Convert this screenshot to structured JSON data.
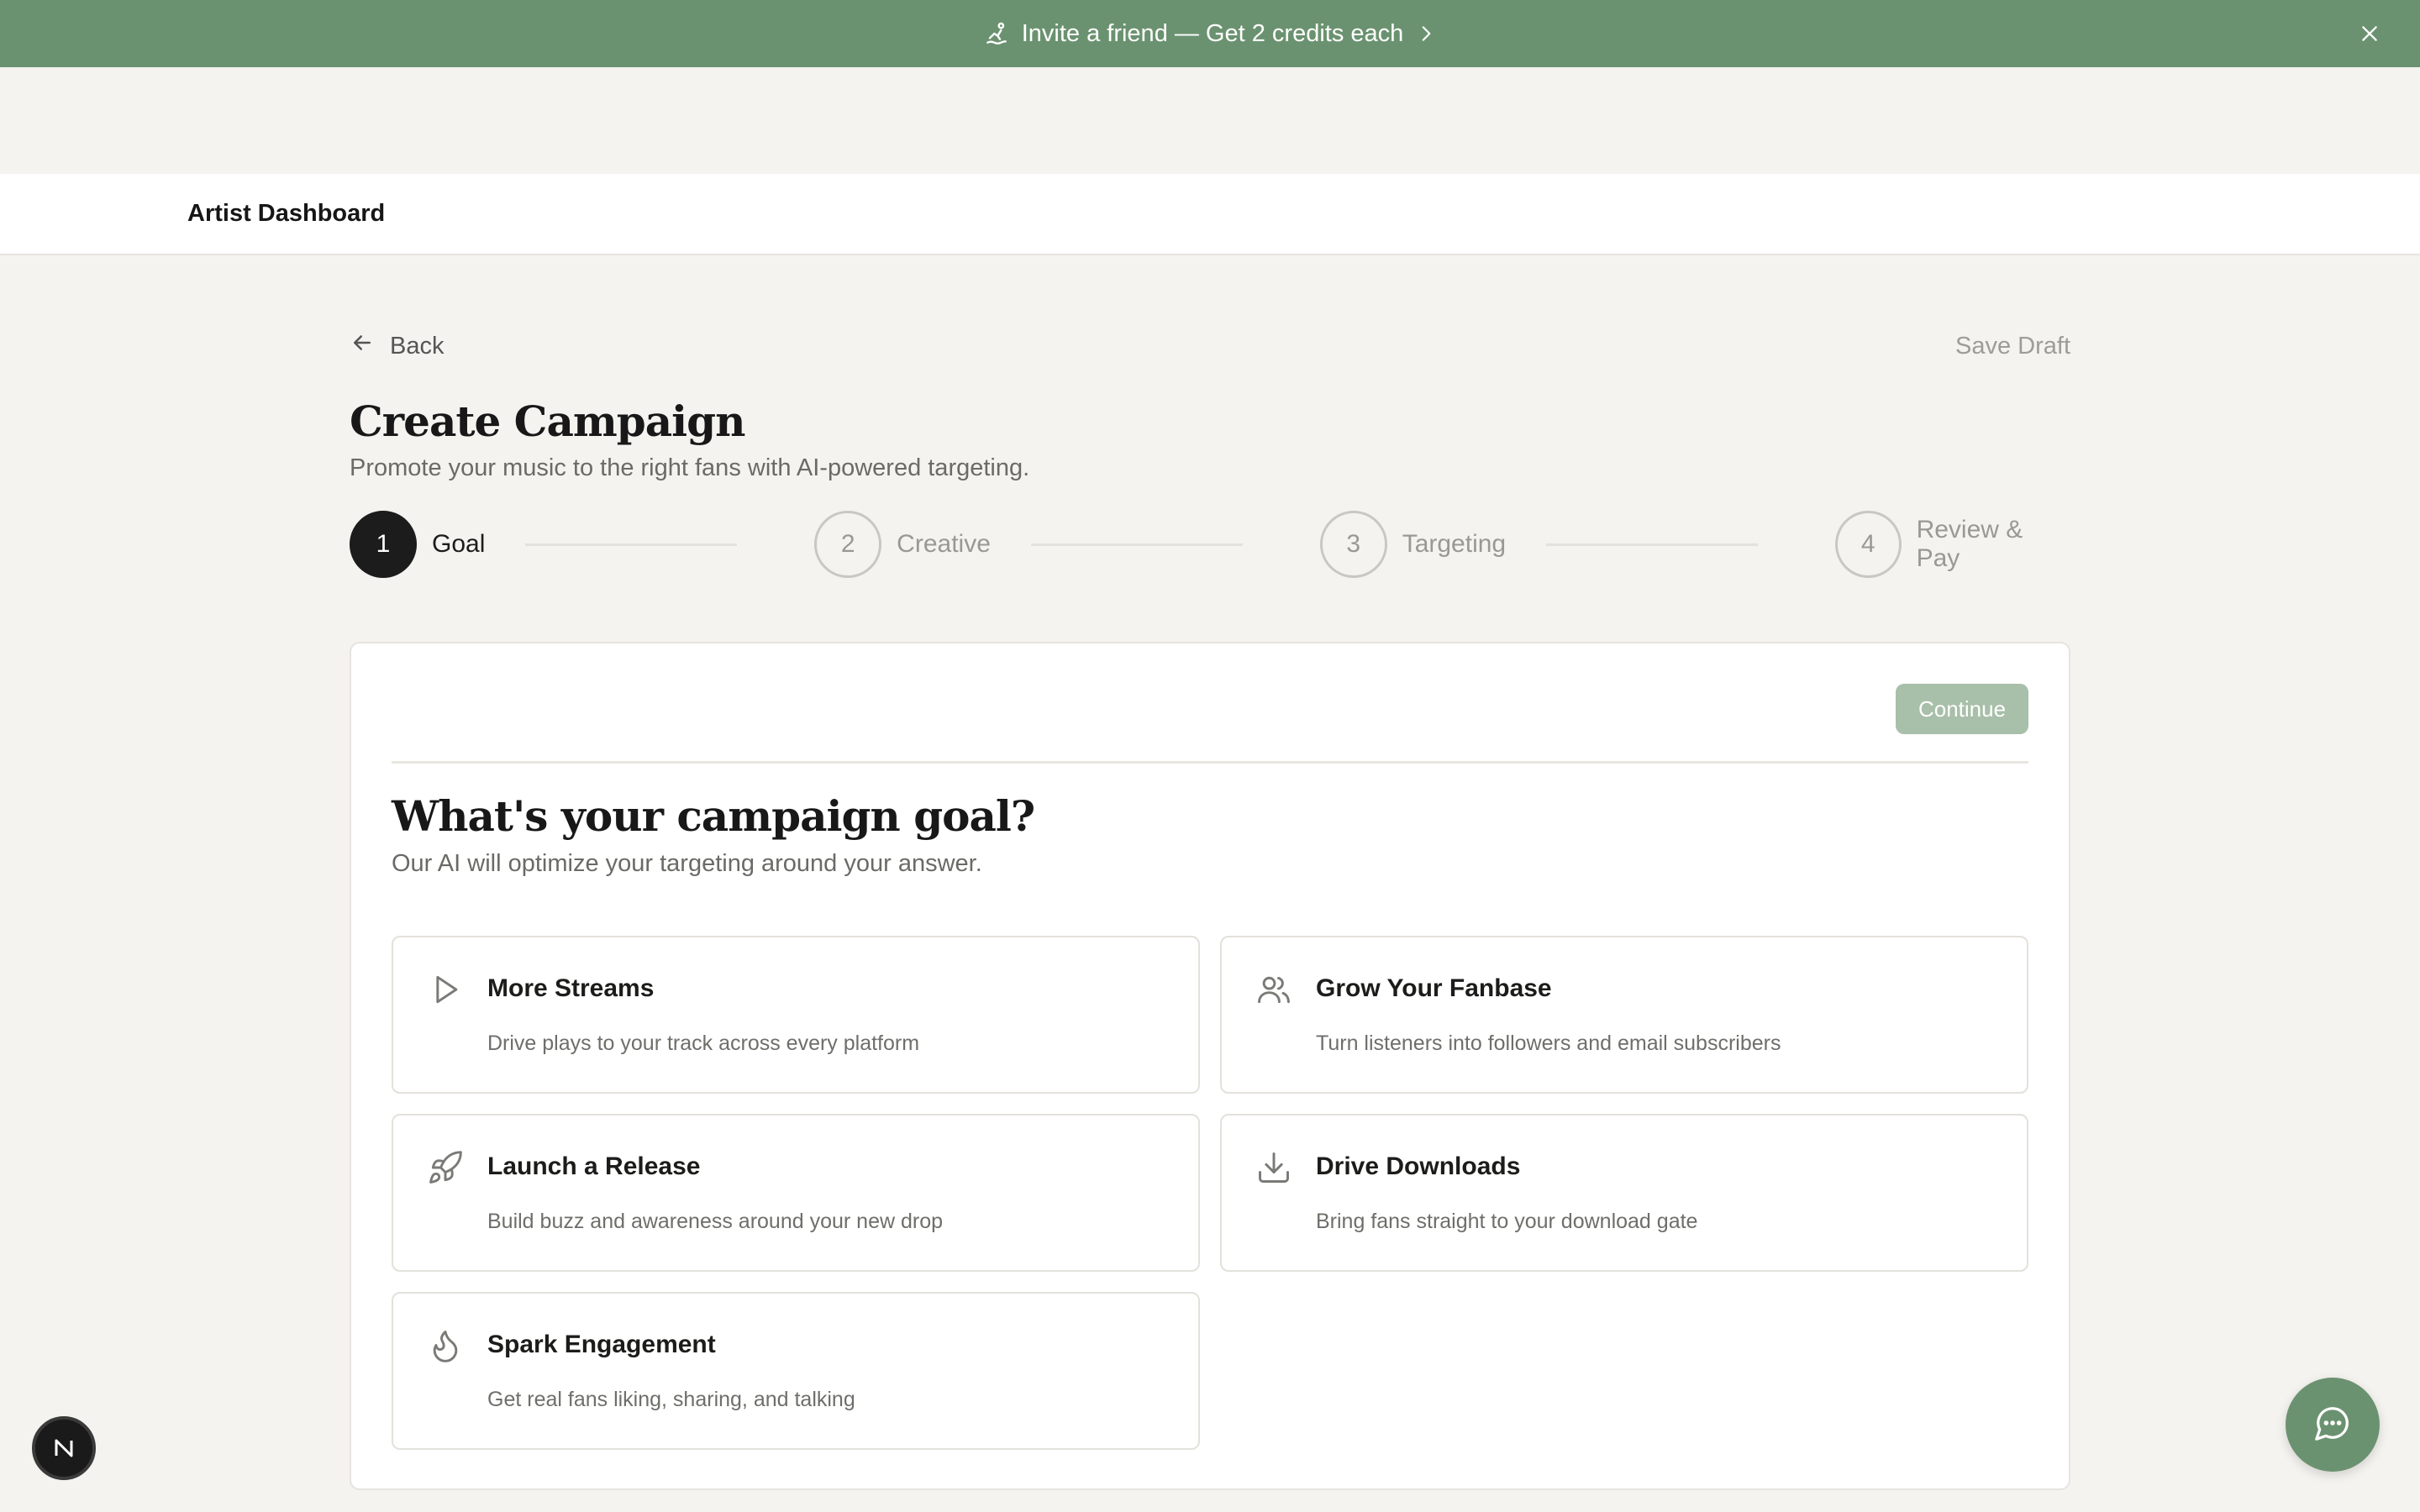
{
  "banner": {
    "text": "Invite a friend — Get 2 credits each",
    "icon": "wave-hand-icon",
    "bg_color": "#6b9270"
  },
  "nav": {
    "brand": "Artist Dashboard"
  },
  "header": {
    "back_label": "Back",
    "save_draft_label": "Save Draft",
    "title": "Create Campaign",
    "subtitle": "Promote your music to the right fans with AI-powered targeting."
  },
  "steps": [
    {
      "num": "1",
      "label": "Goal",
      "active": true
    },
    {
      "num": "2",
      "label": "Creative",
      "active": false
    },
    {
      "num": "3",
      "label": "Targeting",
      "active": false
    },
    {
      "num": "4",
      "label": "Review & Pay",
      "active": false
    }
  ],
  "goal": {
    "continue_label": "Continue",
    "question": "What's your campaign goal?",
    "question_sub": "Our AI will optimize your targeting around your answer.",
    "options": [
      {
        "title": "More Streams",
        "desc": "Drive plays to your track across every platform",
        "icon": "play-icon"
      },
      {
        "title": "Grow Your Fanbase",
        "desc": "Turn listeners into followers and email subscribers",
        "icon": "users-icon"
      },
      {
        "title": "Launch a Release",
        "desc": "Build buzz and awareness around your new drop",
        "icon": "rocket-icon"
      },
      {
        "title": "Drive Downloads",
        "desc": "Bring fans straight to your download gate",
        "icon": "download-icon"
      },
      {
        "title": "Spark Engagement",
        "desc": "Get real fans liking, sharing, and talking",
        "icon": "flame-icon"
      }
    ]
  },
  "badge": {
    "letter": "N"
  },
  "accent_color": "#6b9270"
}
